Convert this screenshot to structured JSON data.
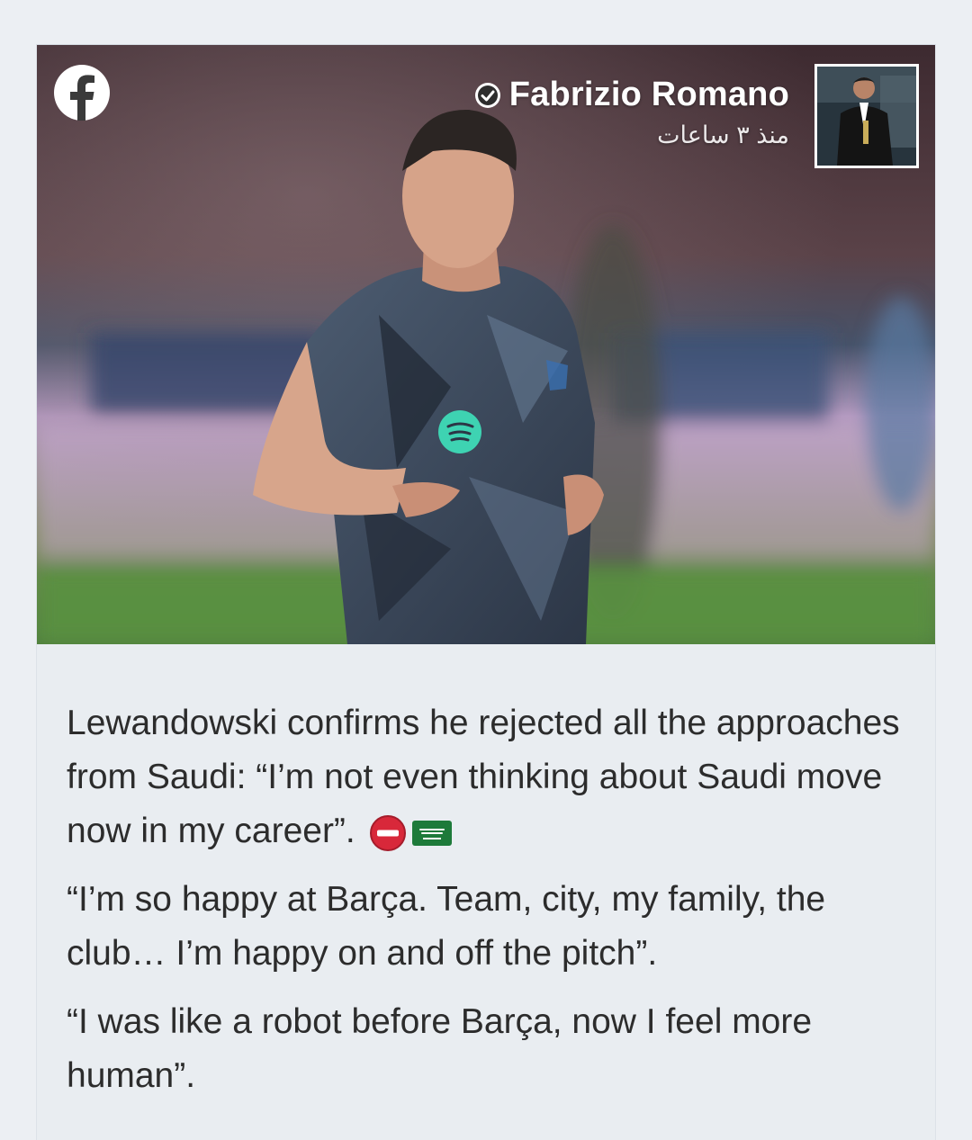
{
  "post": {
    "author": "Fabrizio Romano",
    "timestamp": "منذ ٣ ساعات",
    "paragraphs": [
      "Lewandowski confirms he rejected all the approaches from Saudi: “I’m not even thinking about Saudi move now in my career”.",
      "“I’m so happy at Barça. Team, city, my family, the club… I’m happy on and off the pitch”.",
      "“I was like a robot before Barça, now I feel more human”."
    ]
  },
  "icons": {
    "platform": "facebook-icon",
    "verified": "verified-check-icon",
    "emoji_1": "no-entry-emoji",
    "emoji_2": "saudi-arabia-flag-emoji"
  },
  "colors": {
    "page_background": "#eceff3",
    "text": "#2c2c2c",
    "header_text": "#ffffff",
    "no_entry_red": "#d8283a",
    "saudi_green": "#1d7a3a"
  }
}
